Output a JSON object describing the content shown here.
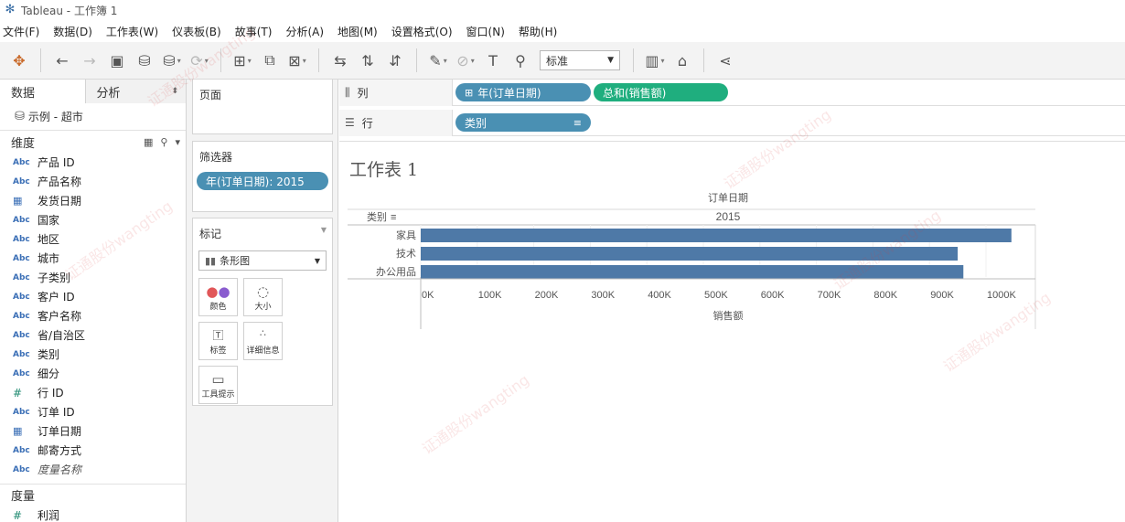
{
  "window": {
    "title": "Tableau - 工作簿 1"
  },
  "menu": [
    "文件(F)",
    "数据(D)",
    "工作表(W)",
    "仪表板(B)",
    "故事(T)",
    "分析(A)",
    "地图(M)",
    "设置格式(O)",
    "窗口(N)",
    "帮助(H)"
  ],
  "toolbar": {
    "fit_select": "标准"
  },
  "left_pane": {
    "tab_data": "数据",
    "tab_analysis": "分析",
    "datasource": "示例 - 超市",
    "dimensions_label": "维度",
    "measures_label": "度量",
    "dimensions": [
      {
        "type": "Abc",
        "name": "产品 ID"
      },
      {
        "type": "Abc",
        "name": "产品名称"
      },
      {
        "type": "cal",
        "name": "发货日期"
      },
      {
        "type": "Abc",
        "name": "国家"
      },
      {
        "type": "Abc",
        "name": "地区"
      },
      {
        "type": "Abc",
        "name": "城市"
      },
      {
        "type": "Abc",
        "name": "子类别"
      },
      {
        "type": "Abc",
        "name": "客户 ID"
      },
      {
        "type": "Abc",
        "name": "客户名称"
      },
      {
        "type": "Abc",
        "name": "省/自治区"
      },
      {
        "type": "Abc",
        "name": "类别"
      },
      {
        "type": "Abc",
        "name": "细分"
      },
      {
        "type": "#",
        "name": "行 ID"
      },
      {
        "type": "Abc",
        "name": "订单 ID"
      },
      {
        "type": "cal",
        "name": "订单日期"
      },
      {
        "type": "Abc",
        "name": "邮寄方式"
      },
      {
        "type": "Abc",
        "name": "度量名称"
      }
    ],
    "measures": [
      {
        "type": "#",
        "name": "利润"
      }
    ]
  },
  "pages_card": {
    "title": "页面"
  },
  "filters_card": {
    "title": "筛选器",
    "pill": "年(订单日期): 2015"
  },
  "marks_card": {
    "title": "标记",
    "mark_type": "条形图",
    "buttons": [
      "颜色",
      "大小",
      "标签",
      "详细信息",
      "工具提示"
    ]
  },
  "shelves": {
    "columns_label": "列",
    "rows_label": "行",
    "columns_pills": [
      "年(订单日期)",
      "总和(销售额)"
    ],
    "rows_pills": [
      "类别"
    ]
  },
  "sheet": {
    "title": "工作表 1"
  },
  "chart_data": {
    "type": "bar",
    "orientation": "horizontal",
    "header_title": "订单日期",
    "header_value": "2015",
    "row_header": "类别",
    "categories": [
      "家具",
      "技术",
      "办公用品"
    ],
    "values": [
      1045000,
      950000,
      960000
    ],
    "xlabel": "销售额",
    "xlim": [
      0,
      1100000
    ],
    "xticks": [
      0,
      100000,
      200000,
      300000,
      400000,
      500000,
      600000,
      700000,
      800000,
      900000,
      1000000
    ],
    "xtick_labels": [
      "0K",
      "100K",
      "200K",
      "300K",
      "400K",
      "500K",
      "600K",
      "700K",
      "800K",
      "900K",
      "1000K"
    ],
    "bar_color": "#4e79a7"
  }
}
